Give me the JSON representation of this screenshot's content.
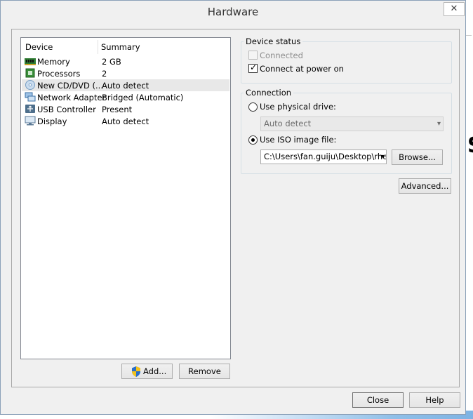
{
  "window": {
    "title": "Hardware",
    "close_glyph": "✕"
  },
  "device_list": {
    "headers": {
      "device": "Device",
      "summary": "Summary"
    },
    "items": [
      {
        "icon": "memory-icon",
        "device": "Memory",
        "summary": "2 GB"
      },
      {
        "icon": "processor-icon",
        "device": "Processors",
        "summary": "2"
      },
      {
        "icon": "cd-dvd-icon",
        "device": "New CD/DVD (...",
        "summary": "Auto detect",
        "selected": true
      },
      {
        "icon": "network-adapter-icon",
        "device": "Network Adapter",
        "summary": "Bridged (Automatic)"
      },
      {
        "icon": "usb-icon",
        "device": "USB Controller",
        "summary": "Present"
      },
      {
        "icon": "display-icon",
        "device": "Display",
        "summary": "Auto detect"
      }
    ]
  },
  "buttons": {
    "add": "Add...",
    "remove": "Remove",
    "browse": "Browse...",
    "advanced": "Advanced...",
    "close": "Close",
    "help": "Help"
  },
  "device_status": {
    "title": "Device status",
    "connected": {
      "label": "Connected",
      "checked": false,
      "disabled": true
    },
    "connect_at_power_on": {
      "label": "Connect at power on",
      "checked": true
    }
  },
  "connection": {
    "title": "Connection",
    "physical_drive": {
      "label": "Use physical drive:",
      "selected": false,
      "value": "Auto detect"
    },
    "iso_image": {
      "label": "Use ISO image file:",
      "selected": true,
      "value": "C:\\Users\\fan.guiju\\Desktop\\rhel"
    }
  },
  "colors": {
    "accent": "#0078d7",
    "selection": "#e8e8e8"
  }
}
